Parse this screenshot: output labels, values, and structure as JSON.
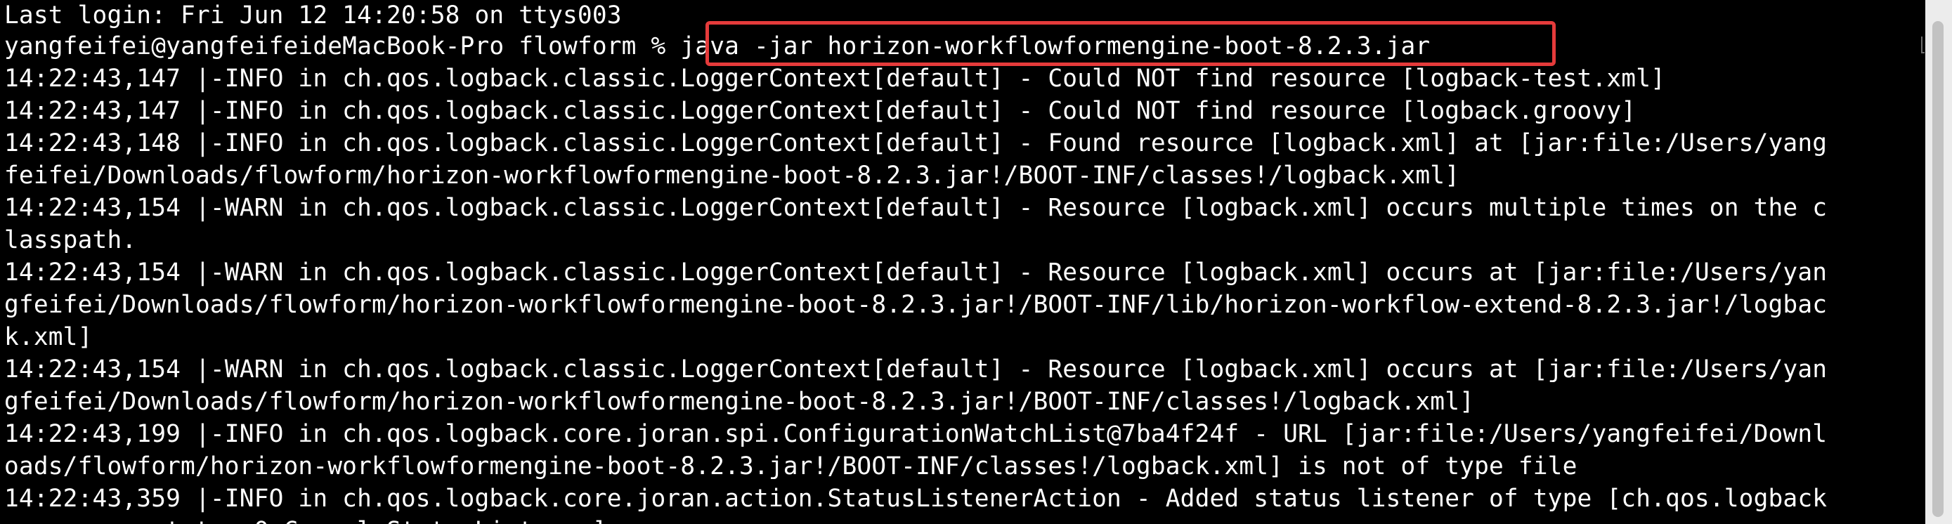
{
  "terminal": {
    "lines": [
      "Last login: Fri Jun 12 14:20:58 on ttys003",
      "yangfeifei@yangfeifeideMacBook-Pro flowform % java -jar horizon-workflowformengine-boot-8.2.3.jar",
      "14:22:43,147 |-INFO in ch.qos.logback.classic.LoggerContext[default] - Could NOT find resource [logback-test.xml]",
      "14:22:43,147 |-INFO in ch.qos.logback.classic.LoggerContext[default] - Could NOT find resource [logback.groovy]",
      "14:22:43,148 |-INFO in ch.qos.logback.classic.LoggerContext[default] - Found resource [logback.xml] at [jar:file:/Users/yang",
      "feifei/Downloads/flowform/horizon-workflowformengine-boot-8.2.3.jar!/BOOT-INF/classes!/logback.xml]",
      "14:22:43,154 |-WARN in ch.qos.logback.classic.LoggerContext[default] - Resource [logback.xml] occurs multiple times on the c",
      "lasspath.",
      "14:22:43,154 |-WARN in ch.qos.logback.classic.LoggerContext[default] - Resource [logback.xml] occurs at [jar:file:/Users/yan",
      "gfeifei/Downloads/flowform/horizon-workflowformengine-boot-8.2.3.jar!/BOOT-INF/lib/horizon-workflow-extend-8.2.3.jar!/logbac",
      "k.xml]",
      "14:22:43,154 |-WARN in ch.qos.logback.classic.LoggerContext[default] - Resource [logback.xml] occurs at [jar:file:/Users/yan",
      "gfeifei/Downloads/flowform/horizon-workflowformengine-boot-8.2.3.jar!/BOOT-INF/classes!/logback.xml]",
      "14:22:43,199 |-INFO in ch.qos.logback.core.joran.spi.ConfigurationWatchList@7ba4f24f - URL [jar:file:/Users/yangfeifei/Downl",
      "oads/flowform/horizon-workflowformengine-boot-8.2.3.jar!/BOOT-INF/classes!/logback.xml] is not of type file",
      "14:22:43,359 |-INFO in ch.qos.logback.core.joran.action.StatusListenerAction - Added status listener of type [ch.qos.logback",
      "    .core.status.OnConsoleStatusListener]"
    ]
  },
  "colors": {
    "background": "#000000",
    "text": "#ffffff",
    "highlight_border": "#e53b3b",
    "scrollbar_track": "#ececec",
    "scrollbar_thumb": "#c2c2c2"
  }
}
